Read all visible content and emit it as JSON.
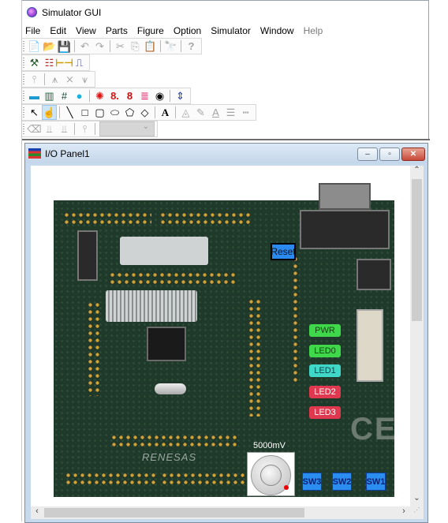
{
  "app": {
    "title": "Simulator GUI",
    "icon": "app-orb-icon"
  },
  "menu": {
    "items": [
      {
        "label": "File",
        "enabled": true
      },
      {
        "label": "Edit",
        "enabled": true
      },
      {
        "label": "View",
        "enabled": true
      },
      {
        "label": "Parts",
        "enabled": true
      },
      {
        "label": "Figure",
        "enabled": true
      },
      {
        "label": "Option",
        "enabled": true
      },
      {
        "label": "Simulator",
        "enabled": true
      },
      {
        "label": "Window",
        "enabled": true
      },
      {
        "label": "Help",
        "enabled": false
      }
    ]
  },
  "toolbars": {
    "standard": [
      "new-file-icon",
      "open-folder-icon",
      "save-icon",
      "undo-icon",
      "redo-icon",
      "cut-icon",
      "copy-icon",
      "paste-icon",
      "find-icon",
      "help-icon"
    ],
    "simulation": [
      "probe-icon",
      "io-panel-icon",
      "timing-icon",
      "waveform-icon"
    ],
    "connection": [
      "pin-icon",
      "connect-icon",
      "disconnect-icon",
      "connect-all-icon"
    ],
    "parts": [
      "button-part-icon",
      "level-meter-icon",
      "matrix-icon",
      "knob-icon",
      "led-icon",
      "7seg-icon",
      "7seg-dp-icon",
      "dot-matrix-icon",
      "buzzer-icon",
      "updown-icon"
    ],
    "draw": [
      "select-arrow-icon",
      "hand-icon",
      "line-icon",
      "rectangle-icon",
      "rounded-rect-icon",
      "ellipse-icon",
      "polygon-icon",
      "arc-icon",
      "text-icon",
      "fill-color-icon",
      "line-color-icon",
      "text-color-icon",
      "line-width-icon",
      "line-style-icon"
    ],
    "misc": [
      "eraser-icon",
      "pin-in-icon",
      "pin-out-icon",
      "net-icon"
    ],
    "combo_value": ""
  },
  "child_window": {
    "title": "I/O Panel1",
    "buttons": {
      "minimize": "–",
      "maximize": "▫",
      "close": "✕"
    }
  },
  "panel": {
    "reset_label": "Reset",
    "leds": [
      {
        "label": "PWR",
        "color": "#3fd84a",
        "state": "on"
      },
      {
        "label": "LED0",
        "color": "#3fd84a",
        "state": "on"
      },
      {
        "label": "LED1",
        "color": "#3fd8c8",
        "state": "on"
      },
      {
        "label": "LED2",
        "color": "#e0384f",
        "state": "on"
      },
      {
        "label": "LED3",
        "color": "#e0384f",
        "state": "on"
      }
    ],
    "switches": [
      "SW3",
      "SW2",
      "SW1"
    ],
    "knob": {
      "label": "5000mV",
      "value_mv": 5000
    },
    "board_brand": "RENESAS"
  },
  "scroll": {
    "vertical_position": 0,
    "horizontal_position": 0
  }
}
